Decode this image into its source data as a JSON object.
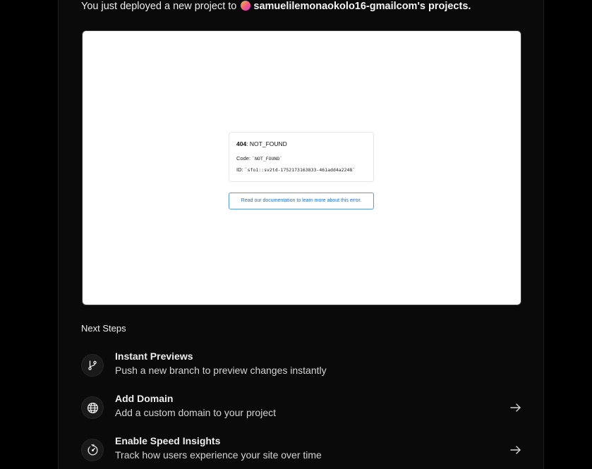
{
  "deploy": {
    "message_prefix": "You just deployed a new project to",
    "account": "samuelilemonaokolo16-gmailcom's projects."
  },
  "preview": {
    "error_code_num": "404",
    "error_code_text": ": NOT_FOUND",
    "code_label": "Code: ",
    "code_value": "`NOT_FOUND`",
    "id_label": "ID: ",
    "id_value": "`sfo1::sv2td-1752173163833-461add4a2248`",
    "doc_link": "Read our documentation to learn more about this error."
  },
  "next_steps": {
    "title": "Next Steps",
    "items": [
      {
        "title": "Instant Previews",
        "desc": "Push a new branch to preview changes instantly",
        "icon": "git-branch-icon",
        "has_arrow": false
      },
      {
        "title": "Add Domain",
        "desc": "Add a custom domain to your project",
        "icon": "globe-icon",
        "has_arrow": true
      },
      {
        "title": "Enable Speed Insights",
        "desc": "Track how users experience your site over time",
        "icon": "speed-gauge-icon",
        "has_arrow": true
      }
    ]
  },
  "colors": {
    "background": "#000000",
    "panel": "#0a0a0a",
    "link_blue": "#1a6dcc"
  }
}
